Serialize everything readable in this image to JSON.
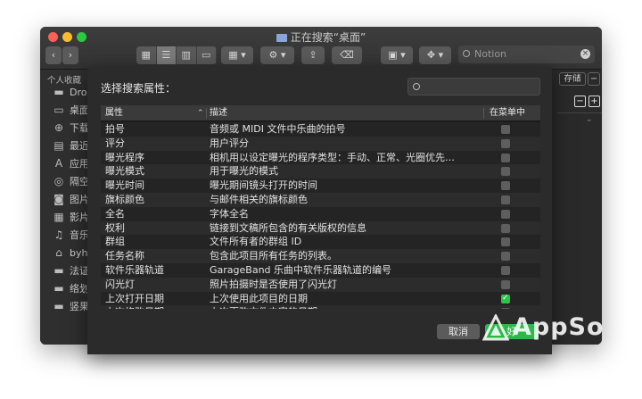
{
  "window": {
    "title": "正在搜索“桌面”"
  },
  "toolbar": {
    "back": "‹",
    "forward": "›",
    "search_value": "Notion"
  },
  "sidebar": {
    "section": "个人收藏",
    "items": [
      {
        "icon": "folder-icon",
        "label": "Dro"
      },
      {
        "icon": "desktop-icon",
        "label": "桌面"
      },
      {
        "icon": "download-icon",
        "label": "下载"
      },
      {
        "icon": "recents-icon",
        "label": "最近"
      },
      {
        "icon": "applications-icon",
        "label": "应用"
      },
      {
        "icon": "airdrop-icon",
        "label": "隔空"
      },
      {
        "icon": "pictures-icon",
        "label": "图片"
      },
      {
        "icon": "movies-icon",
        "label": "影片"
      },
      {
        "icon": "music-icon",
        "label": "音乐"
      },
      {
        "icon": "home-icon",
        "label": "byh"
      },
      {
        "icon": "folder-icon",
        "label": "法证"
      },
      {
        "icon": "folder-icon",
        "label": "络划"
      },
      {
        "icon": "folder-icon",
        "label": "竖果"
      }
    ]
  },
  "rightbar": {
    "save_label": "存储",
    "minus": "−",
    "plus": "+"
  },
  "sheet": {
    "title": "选择搜索属性：",
    "columns": {
      "attribute": "属性",
      "description": "描述",
      "in_menu": "在菜单中"
    },
    "rows": [
      {
        "attr": "拍号",
        "desc": "音频或 MIDI 文件中乐曲的拍号",
        "checked": false
      },
      {
        "attr": "评分",
        "desc": "用户评分",
        "checked": false
      },
      {
        "attr": "曝光程序",
        "desc": "相机用以设定曝光的程序类型：手动、正常、光圈优先…",
        "checked": false
      },
      {
        "attr": "曝光模式",
        "desc": "用于曝光的模式",
        "checked": false
      },
      {
        "attr": "曝光时间",
        "desc": "曝光期间镜头打开的时间",
        "checked": false
      },
      {
        "attr": "旗标颜色",
        "desc": "与邮件相关的旗标颜色",
        "checked": false
      },
      {
        "attr": "全名",
        "desc": "字体全名",
        "checked": false
      },
      {
        "attr": "权利",
        "desc": "链接到文稿所包含的有关版权的信息",
        "checked": false
      },
      {
        "attr": "群组",
        "desc": "文件所有者的群组 ID",
        "checked": false
      },
      {
        "attr": "任务名称",
        "desc": "包含此项目所有任务的列表。",
        "checked": false
      },
      {
        "attr": "软件乐器轨道",
        "desc": "GarageBand 乐曲中软件乐器轨道的编号",
        "checked": false
      },
      {
        "attr": "闪光灯",
        "desc": "照片拍摄时是否使用了闪光灯",
        "checked": false
      },
      {
        "attr": "上次打开日期",
        "desc": "上次使用此项目的日期",
        "checked": true
      },
      {
        "attr": "上次修改日期",
        "desc": "上次更改文件内容的日期",
        "checked": false
      }
    ],
    "cancel_label": "取消",
    "ok_label": "好"
  },
  "watermark": {
    "text": "AppSo"
  }
}
